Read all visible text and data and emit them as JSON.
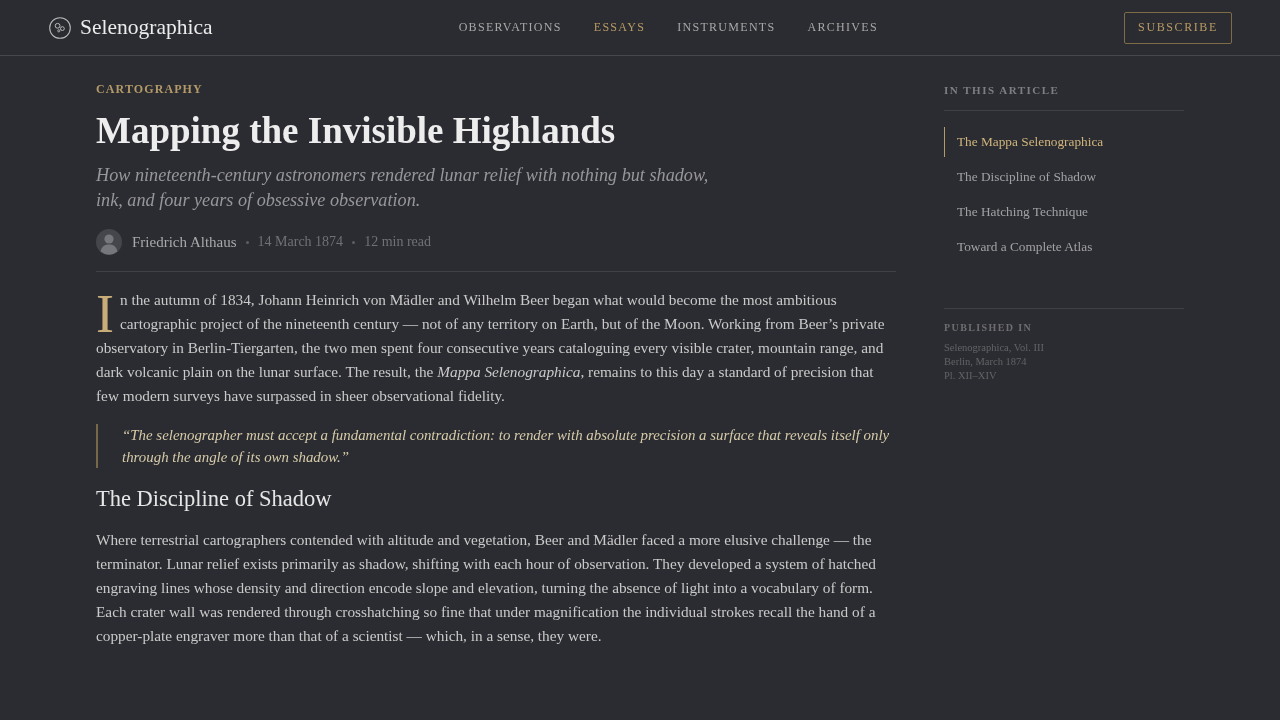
{
  "header": {
    "brand": "Selenographica",
    "nav": [
      {
        "label": "OBSERVATIONS",
        "selected": false
      },
      {
        "label": "ESSAYS",
        "selected": true
      },
      {
        "label": "INSTRUMENTS",
        "selected": false
      },
      {
        "label": "ARCHIVES",
        "selected": false
      }
    ],
    "subscribe": "SUBSCRIBE"
  },
  "article": {
    "category": "CARTOGRAPHY",
    "title": "Mapping the Invisible Highlands",
    "subtitle": "How nineteenth-century astronomers rendered lunar relief with nothing but shadow, ink, and four years of obsessive observation.",
    "byline": {
      "author": "Friedrich Althaus",
      "date": "14 March 1874",
      "read_time": "12 min read"
    },
    "body": [
      {
        "kind": "paragraph",
        "drop_cap": "I",
        "text": "n the autumn of 1834, Johann Heinrich von Mädler and Wilhelm Beer began what would become the most ambitious cartographic project of the nineteenth century — not of any territory on Earth, but of the Moon. Working from Beer’s private observatory in Berlin-Tiergarten, the two men spent four consecutive years cataloguing every visible crater, mountain range, and dark volcanic plain on the lunar surface. The result, the *Mappa Selenographica*, remains to this day a standard of precision that few modern surveys have surpassed in sheer observational fidelity."
      },
      {
        "kind": "quote",
        "text": "“The selenographer must accept a fundamental contradiction: to render with absolute precision a surface that reveals itself only through the angle of its own shadow.”"
      },
      {
        "kind": "heading",
        "text": "The Discipline of Shadow"
      },
      {
        "kind": "paragraph",
        "text": "Where terrestrial cartographers contended with altitude and vegetation, Beer and Mädler faced a more elusive challenge — the terminator. Lunar relief exists primarily as shadow, shifting with each hour of observation. They developed a system of hatched engraving lines whose density and direction encode slope and elevation, turning the absence of light into a vocabulary of form. Each crater wall was rendered through crosshatching so fine that under magnification the individual strokes recall the hand of a copper-plate engraver more than that of a scientist — which, in a sense, they were."
      }
    ]
  },
  "sidebar": {
    "toc_title": "IN THIS ARTICLE",
    "toc": [
      {
        "label": "The Mappa Selenographica",
        "selected": true
      },
      {
        "label": "The Discipline of Shadow",
        "selected": false
      },
      {
        "label": "The Hatching Technique",
        "selected": false
      },
      {
        "label": "Toward a Complete Atlas",
        "selected": false
      }
    ],
    "published_title": "PUBLISHED IN",
    "published_lines": [
      "Selenographica, Vol. III",
      "Berlin, March 1874",
      "Pl. XII–XIV"
    ]
  }
}
